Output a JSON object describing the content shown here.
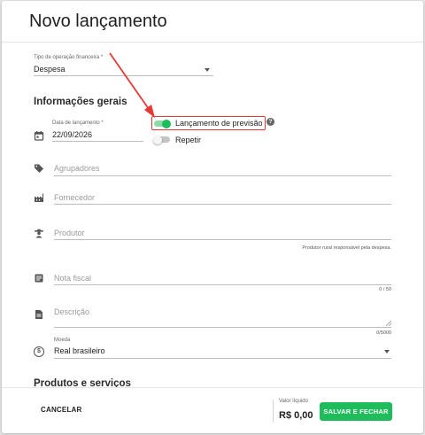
{
  "dialog": {
    "title": "Novo lançamento"
  },
  "operation_type": {
    "label": "Tipo de operação financeira *",
    "value": "Despesa"
  },
  "general_section": {
    "title": "Informações gerais"
  },
  "launch_date": {
    "label": "Data de lançamento *",
    "value": "22/09/2026"
  },
  "forecast_toggle": {
    "label": "Lançamento de previsão",
    "on": true,
    "help_glyph": "?"
  },
  "repeat_toggle": {
    "label": "Repetir",
    "on": false
  },
  "groupers": {
    "placeholder": "Agrupadores"
  },
  "supplier": {
    "placeholder": "Fornecedor"
  },
  "producer": {
    "placeholder": "Produtor",
    "hint": "Produtor rural responsável pela despesa."
  },
  "invoice": {
    "placeholder": "Nota fiscal",
    "counter": "0 / 50"
  },
  "description": {
    "placeholder": "Descrição",
    "counter": "0/5000"
  },
  "currency": {
    "label": "Moeda",
    "value": "Real brasileiro",
    "symbol": "$"
  },
  "products_section": {
    "title": "Produtos e serviços"
  },
  "footer": {
    "cancel_label": "CANCELAR",
    "net_value_label": "Valor líquido",
    "net_value": "R$ 0,00",
    "save_close_label": "SALVAR E FECHAR"
  },
  "colors": {
    "accent": "#1fbc5c",
    "annotation": "#e53935",
    "toggle_on_track": "#8fd9a8",
    "toggle_off_track": "#c4c4c4"
  },
  "icons": [
    "calendar-icon",
    "tag-icon",
    "factory-icon",
    "farmer-icon",
    "receipt-icon",
    "document-icon",
    "currency-icon",
    "chevron-down-icon",
    "help-icon",
    "red-arrow-annotation"
  ]
}
